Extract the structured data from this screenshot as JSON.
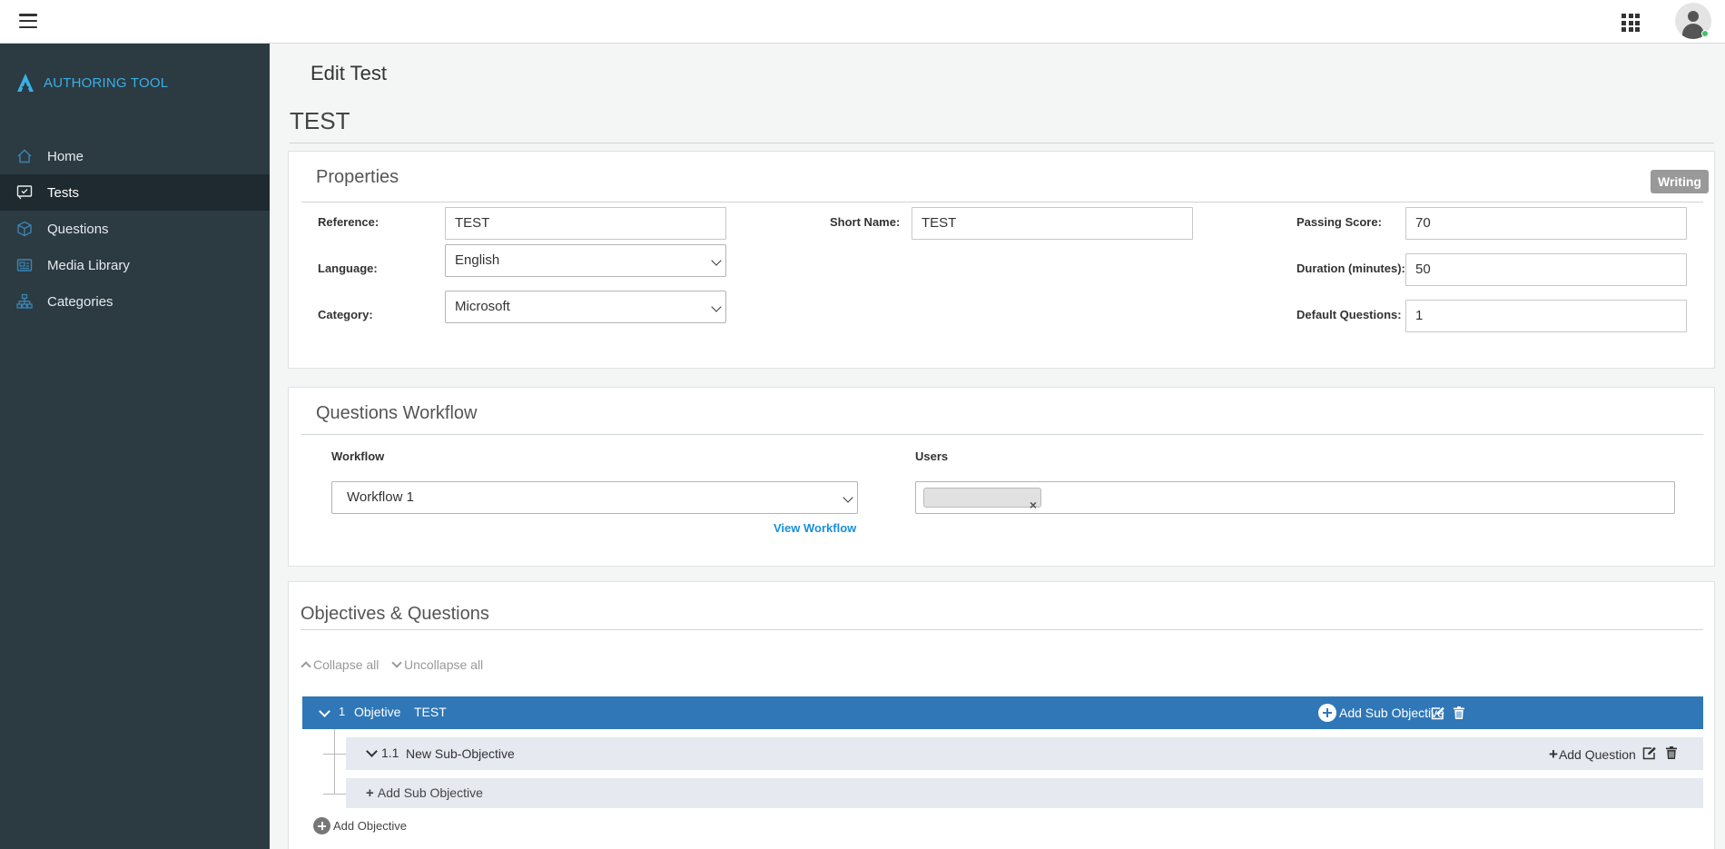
{
  "app": {
    "brand": "AUTHORING TOOL",
    "brand_color": "#3ab0e6"
  },
  "topbar": {
    "menu_icon": "hamburger-icon",
    "apps_icon": "apps-grid-icon",
    "avatar_icon": "user-avatar-icon",
    "status": "online"
  },
  "sidebar": {
    "items": [
      {
        "label": "Home",
        "icon": "home-icon",
        "active": false
      },
      {
        "label": "Tests",
        "icon": "test-icon",
        "active": true
      },
      {
        "label": "Questions",
        "icon": "questions-icon",
        "active": false
      },
      {
        "label": "Media Library",
        "icon": "media-icon",
        "active": false
      },
      {
        "label": "Categories",
        "icon": "categories-icon",
        "active": false
      }
    ]
  },
  "page": {
    "title": "Edit Test",
    "test_name": "TEST"
  },
  "properties": {
    "title": "Properties",
    "status_badge": "Writing",
    "reference_label": "Reference:",
    "reference_value": "TEST",
    "short_name_label": "Short Name:",
    "short_name_value": "TEST",
    "passing_score_label": "Passing Score:",
    "passing_score_value": "70",
    "language_label": "Language:",
    "language_value": "English",
    "duration_label": "Duration (minutes):",
    "duration_value": "50",
    "category_label": "Category:",
    "category_value": "Microsoft",
    "default_questions_label": "Default Questions:",
    "default_questions_value": "1"
  },
  "workflow": {
    "title": "Questions Workflow",
    "workflow_label": "Workflow",
    "workflow_value": "Workflow 1",
    "users_label": "Users",
    "view_link": "View Workflow",
    "tag_remove": "×"
  },
  "objectives": {
    "title": "Objectives & Questions",
    "collapse_all": "Collapse all",
    "uncollapse_all": "Uncollapse all",
    "objective": {
      "number": "1",
      "word": "Objetive",
      "name": "TEST",
      "add_sub_label": "Add Sub Objective"
    },
    "sub_objective": {
      "number": "1.1",
      "name": "New Sub-Objective",
      "add_question_label": "Add Question"
    },
    "add_sub_objective_label": "Add Sub Objective",
    "add_objective_label": "Add Objective",
    "accent": "#2f77b7"
  }
}
